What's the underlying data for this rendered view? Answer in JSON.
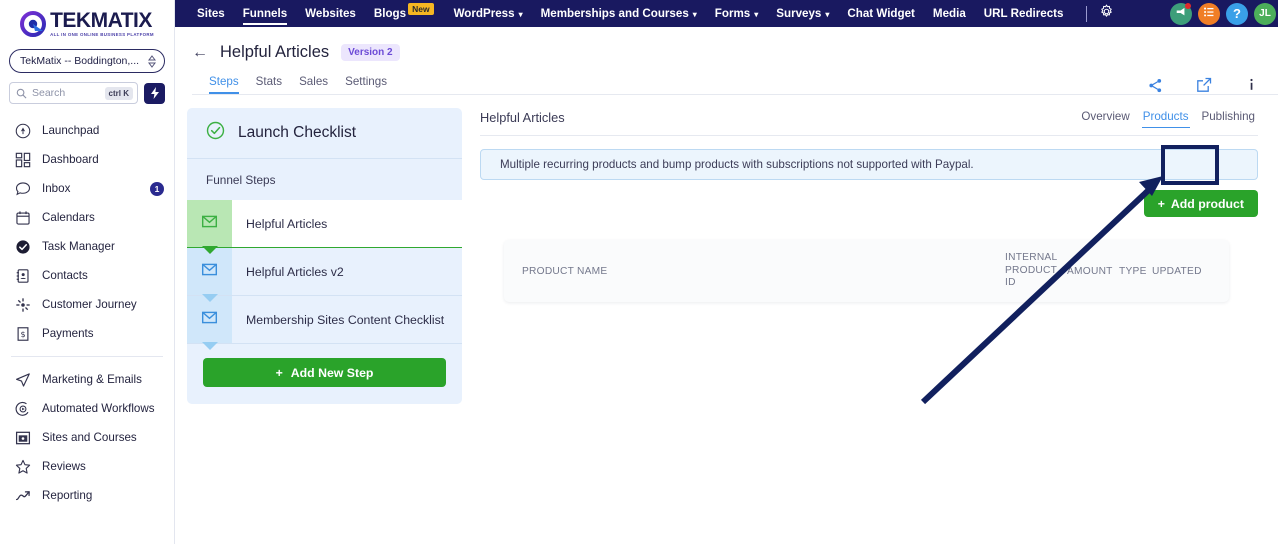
{
  "sidebar": {
    "logo": {
      "name": "TEKMATIX",
      "tagline": "ALL IN ONE ONLINE BUSINESS PLATFORM"
    },
    "account_selector": {
      "value": "TekMatix -- Boddington,..."
    },
    "search": {
      "placeholder": "Search",
      "shortcut": "ctrl K"
    },
    "items": [
      {
        "label": "Launchpad",
        "icon": "launchpad-icon",
        "badge": ""
      },
      {
        "label": "Dashboard",
        "icon": "dashboard-icon",
        "badge": ""
      },
      {
        "label": "Inbox",
        "icon": "inbox-icon",
        "badge": "1"
      },
      {
        "label": "Calendars",
        "icon": "calendar-icon",
        "badge": ""
      },
      {
        "label": "Task Manager",
        "icon": "task-check-icon",
        "badge": ""
      },
      {
        "label": "Contacts",
        "icon": "contacts-icon",
        "badge": ""
      },
      {
        "label": "Customer Journey",
        "icon": "journey-icon",
        "badge": ""
      },
      {
        "label": "Payments",
        "icon": "payments-icon",
        "badge": ""
      }
    ],
    "items2": [
      {
        "label": "Marketing & Emails",
        "icon": "send-icon"
      },
      {
        "label": "Automated Workflows",
        "icon": "workflow-play-icon"
      },
      {
        "label": "Sites and Courses",
        "icon": "sites-icon"
      },
      {
        "label": "Reviews",
        "icon": "star-icon"
      },
      {
        "label": "Reporting",
        "icon": "trending-up-icon"
      }
    ]
  },
  "topnav": {
    "items": [
      {
        "label": "Sites",
        "active": false,
        "caret": false,
        "badge": ""
      },
      {
        "label": "Funnels",
        "active": true,
        "caret": false,
        "badge": ""
      },
      {
        "label": "Websites",
        "active": false,
        "caret": false,
        "badge": ""
      },
      {
        "label": "Blogs",
        "active": false,
        "caret": false,
        "badge": "New"
      },
      {
        "label": "WordPress",
        "active": false,
        "caret": true,
        "badge": ""
      },
      {
        "label": "Memberships and Courses",
        "active": false,
        "caret": true,
        "badge": ""
      },
      {
        "label": "Forms",
        "active": false,
        "caret": true,
        "badge": ""
      },
      {
        "label": "Surveys",
        "active": false,
        "caret": true,
        "badge": ""
      },
      {
        "label": "Chat Widget",
        "active": false,
        "caret": false,
        "badge": ""
      },
      {
        "label": "Media",
        "active": false,
        "caret": false,
        "badge": ""
      },
      {
        "label": "URL Redirects",
        "active": false,
        "caret": false,
        "badge": ""
      }
    ],
    "avatar_initials": "JL"
  },
  "page": {
    "title": "Helpful Articles",
    "version_badge": "Version 2",
    "tabs": [
      {
        "label": "Steps",
        "active": true
      },
      {
        "label": "Stats",
        "active": false
      },
      {
        "label": "Sales",
        "active": false
      },
      {
        "label": "Settings",
        "active": false
      }
    ]
  },
  "checklist": {
    "title": "Launch Checklist",
    "section_label": "Funnel Steps",
    "steps": [
      {
        "label": "Helpful Articles",
        "selected": true
      },
      {
        "label": "Helpful Articles v2",
        "selected": false
      },
      {
        "label": "Membership Sites Content Checklist",
        "selected": false
      }
    ],
    "add_step_label": "Add New Step"
  },
  "content": {
    "title": "Helpful Articles",
    "tabs": [
      {
        "label": "Overview",
        "active": false
      },
      {
        "label": "Products",
        "active": true
      },
      {
        "label": "Publishing",
        "active": false
      }
    ],
    "notice": "Multiple recurring products and bump products with subscriptions not supported with Paypal.",
    "add_product_label": "Add product",
    "table": {
      "columns": [
        "PRODUCT NAME",
        "INTERNAL PRODUCT ID",
        "AMOUNT",
        "TYPE",
        "UPDATED"
      ],
      "rows": []
    }
  },
  "annotation": {
    "highlight_target": "Products",
    "color": "#11205e"
  },
  "colors": {
    "topbar": "#191960",
    "accent_blue": "#4090e8",
    "green": "#2aa32a",
    "panel_blue": "#e8f1fd",
    "annotation": "#11205e"
  }
}
